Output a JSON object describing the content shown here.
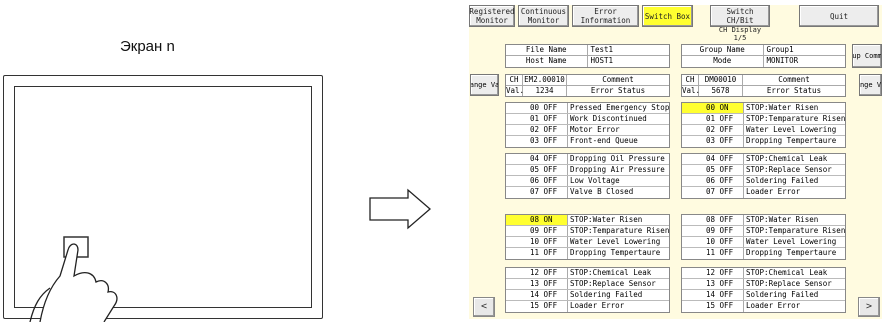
{
  "left": {
    "label": "Экран n"
  },
  "toolbar": [
    {
      "label": "Registered Monitor",
      "active": false
    },
    {
      "label": "Continuous Monitor",
      "active": false
    },
    {
      "label": "Error Information",
      "active": false
    },
    {
      "label": "Switch Box",
      "active": true
    },
    {
      "label": "Switch CH/Bit",
      "active": false
    }
  ],
  "quit_label": "Quit",
  "display_caption": {
    "line1": "CH Display",
    "line2": "1/5"
  },
  "file_info": {
    "file_name_label": "File Name",
    "file_name": "Test1",
    "host_name_label": "Host Name",
    "host_name": "HOST1"
  },
  "group_info": {
    "group_name_label": "Group Name",
    "group_name": "Group1",
    "mode_label": "Mode",
    "mode": "MONITOR"
  },
  "side_buttons": {
    "change_val": "Change Val.",
    "group_comment": "Group Comment",
    "change_val_right": "Change Val."
  },
  "left_panel": {
    "ch_label": "CH",
    "ch": "EM2.00010",
    "comment_label": "Comment",
    "val_label": "Val.",
    "val": "1234",
    "status_label": "Error Status",
    "groups": [
      [
        {
          "bit": "00",
          "state": "OFF",
          "text": "Pressed Emergency Stop"
        },
        {
          "bit": "01",
          "state": "OFF",
          "text": "Work Discontinued"
        },
        {
          "bit": "02",
          "state": "OFF",
          "text": "Motor Error"
        },
        {
          "bit": "03",
          "state": "OFF",
          "text": "Front-end Queue"
        }
      ],
      [
        {
          "bit": "04",
          "state": "OFF",
          "text": "Dropping Oil Pressure"
        },
        {
          "bit": "05",
          "state": "OFF",
          "text": "Dropping Air Pressure"
        },
        {
          "bit": "06",
          "state": "OFF",
          "text": "Low Voltage"
        },
        {
          "bit": "07",
          "state": "OFF",
          "text": "Valve B Closed"
        }
      ],
      [
        {
          "bit": "08",
          "state": "ON",
          "text": "STOP:Water Risen"
        },
        {
          "bit": "09",
          "state": "OFF",
          "text": "STOP:Temparature Risen"
        },
        {
          "bit": "10",
          "state": "OFF",
          "text": "Water Level Lowering"
        },
        {
          "bit": "11",
          "state": "OFF",
          "text": "Dropping Tempertaure"
        }
      ],
      [
        {
          "bit": "12",
          "state": "OFF",
          "text": "STOP:Chemical Leak"
        },
        {
          "bit": "13",
          "state": "OFF",
          "text": "STOP:Replace Sensor"
        },
        {
          "bit": "14",
          "state": "OFF",
          "text": "Soldering Failed"
        },
        {
          "bit": "15",
          "state": "OFF",
          "text": "Loader Error"
        }
      ]
    ]
  },
  "right_panel": {
    "ch_label": "CH",
    "ch": "DM00010",
    "comment_label": "Comment",
    "val_label": "Val.",
    "val": "5678",
    "status_label": "Error Status",
    "groups": [
      [
        {
          "bit": "00",
          "state": "ON",
          "text": "STOP:Water Risen"
        },
        {
          "bit": "01",
          "state": "OFF",
          "text": "STOP:Temparature Risen"
        },
        {
          "bit": "02",
          "state": "OFF",
          "text": "Water Level Lowering"
        },
        {
          "bit": "03",
          "state": "OFF",
          "text": "Dropping Tempertaure"
        }
      ],
      [
        {
          "bit": "04",
          "state": "OFF",
          "text": "STOP:Chemical Leak"
        },
        {
          "bit": "05",
          "state": "OFF",
          "text": "STOP:Replace Sensor"
        },
        {
          "bit": "06",
          "state": "OFF",
          "text": "Soldering Failed"
        },
        {
          "bit": "07",
          "state": "OFF",
          "text": "Loader Error"
        }
      ],
      [
        {
          "bit": "08",
          "state": "OFF",
          "text": "STOP:Water Risen"
        },
        {
          "bit": "09",
          "state": "OFF",
          "text": "STOP:Temparature Risen"
        },
        {
          "bit": "10",
          "state": "OFF",
          "text": "Water Level Lowering"
        },
        {
          "bit": "11",
          "state": "OFF",
          "text": "Dropping Tempertaure"
        }
      ],
      [
        {
          "bit": "12",
          "state": "OFF",
          "text": "STOP:Chemical Leak"
        },
        {
          "bit": "13",
          "state": "OFF",
          "text": "STOP:Replace Sensor"
        },
        {
          "bit": "14",
          "state": "OFF",
          "text": "Soldering Failed"
        },
        {
          "bit": "15",
          "state": "OFF",
          "text": "Loader Error"
        }
      ]
    ]
  },
  "nav": {
    "prev": "<",
    "next": ">"
  },
  "colors": {
    "panel_bg": "#fffbe0",
    "active": "#ffff30"
  }
}
